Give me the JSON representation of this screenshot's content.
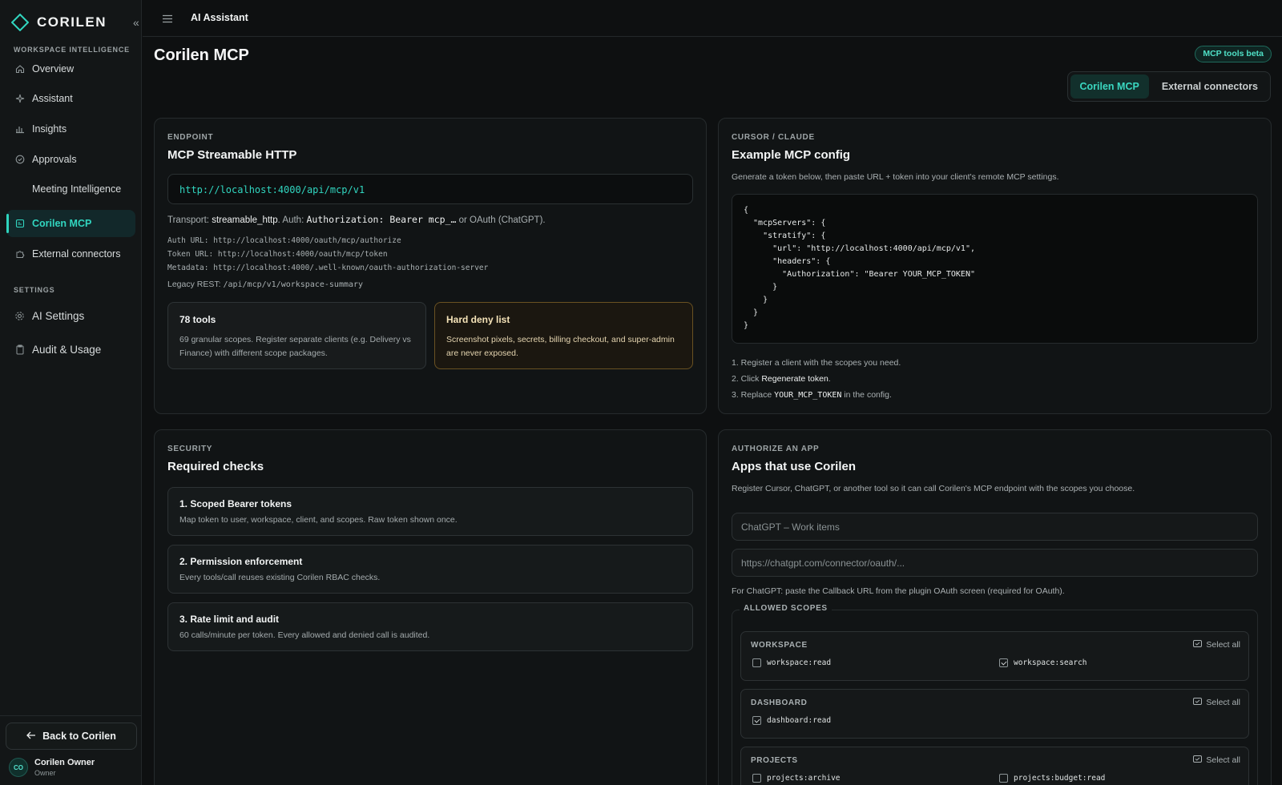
{
  "app": {
    "brand": "CORILEN",
    "topbar_title": "AI Assistant"
  },
  "sidebar": {
    "section_workspace": "WORKSPACE INTELLIGENCE",
    "section_settings": "SETTINGS",
    "items": [
      {
        "label": "Overview",
        "icon": "home-icon"
      },
      {
        "label": "Assistant",
        "icon": "sparkle-icon"
      },
      {
        "label": "Insights",
        "icon": "bar-chart-icon"
      },
      {
        "label": "Approvals",
        "icon": "check-circle-icon"
      },
      {
        "label": "Meeting Intelligence",
        "icon": ""
      },
      {
        "label": "Corilen MCP",
        "icon": "mcp-icon",
        "active": true
      },
      {
        "label": "External connectors",
        "icon": "puzzle-icon"
      }
    ],
    "settings_items": [
      {
        "label": "AI Settings",
        "icon": "gear-icon"
      },
      {
        "label": "Audit & Usage",
        "icon": "clipboard-icon"
      }
    ],
    "back_label": "Back to Corilen",
    "user": {
      "initials": "CO",
      "name": "Corilen Owner",
      "role": "Owner"
    }
  },
  "header": {
    "title": "Corilen MCP",
    "badge": "MCP tools beta",
    "tabs": [
      {
        "label": "Corilen MCP",
        "active": true
      },
      {
        "label": "External connectors",
        "active": false
      }
    ]
  },
  "endpoint": {
    "eyebrow": "ENDPOINT",
    "title": "MCP Streamable HTTP",
    "url": "http://localhost:4000/api/mcp/v1",
    "transport_prefix": "Transport: ",
    "transport_value": "streamable_http",
    "auth_prefix": ". Auth: ",
    "auth_value": "Authorization: Bearer mcp_…",
    "auth_suffix": " or OAuth (ChatGPT).",
    "auth_url": "Auth URL: http://localhost:4000/oauth/mcp/authorize",
    "token_url": "Token URL: http://localhost:4000/oauth/mcp/token",
    "metadata_url": "Metadata: http://localhost:4000/.well-known/oauth-authorization-server",
    "legacy_prefix": "Legacy REST: ",
    "legacy_path": "/api/mcp/v1/workspace-summary",
    "tools_title": "78 tools",
    "tools_desc": "69 granular scopes. Register separate clients (e.g. Delivery vs Finance) with different scope packages.",
    "deny_title": "Hard deny list",
    "deny_desc": "Screenshot pixels, secrets, billing checkout, and super-admin are never exposed."
  },
  "config": {
    "eyebrow": "CURSOR / CLAUDE",
    "title": "Example MCP config",
    "desc": "Generate a token below, then paste URL + token into your client's remote MCP settings.",
    "code": "{\n  \"mcpServers\": {\n    \"stratify\": {\n      \"url\": \"http://localhost:4000/api/mcp/v1\",\n      \"headers\": {\n        \"Authorization\": \"Bearer YOUR_MCP_TOKEN\"\n      }\n    }\n  }\n}",
    "step1": "1. Register a client with the scopes you need.",
    "step2_prefix": "2. Click ",
    "step2_action": "Regenerate token",
    "step2_suffix": ".",
    "step3_prefix": "3. Replace ",
    "step3_token": "YOUR_MCP_TOKEN",
    "step3_suffix": " in the config."
  },
  "security": {
    "eyebrow": "SECURITY",
    "title": "Required checks",
    "checks": [
      {
        "title": "1. Scoped Bearer tokens",
        "desc": "Map token to user, workspace, client, and scopes. Raw token shown once."
      },
      {
        "title": "2. Permission enforcement",
        "desc": "Every tools/call reuses existing Corilen RBAC checks."
      },
      {
        "title": "3. Rate limit and audit",
        "desc": "60 calls/minute per token. Every allowed and denied call is audited."
      }
    ]
  },
  "authorize": {
    "eyebrow": "AUTHORIZE AN APP",
    "title": "Apps that use Corilen",
    "desc": "Register Cursor, ChatGPT, or another tool so it can call Corilen's MCP endpoint with the scopes you choose.",
    "name_placeholder": "ChatGPT – Work items",
    "callback_placeholder": "https://chatgpt.com/connector/oauth/...",
    "callback_help": "For ChatGPT: paste the Callback URL from the plugin OAuth screen (required for OAuth).",
    "scopes_legend": "ALLOWED SCOPES",
    "select_all": "Select all",
    "groups": [
      {
        "name": "WORKSPACE",
        "scopes": [
          {
            "id": "workspace:read",
            "checked": false
          },
          {
            "id": "workspace:search",
            "checked": true
          }
        ]
      },
      {
        "name": "DASHBOARD",
        "scopes": [
          {
            "id": "dashboard:read",
            "checked": true
          }
        ]
      },
      {
        "name": "PROJECTS",
        "scopes": [
          {
            "id": "projects:archive",
            "checked": false
          },
          {
            "id": "projects:budget:read",
            "checked": false
          }
        ]
      }
    ]
  },
  "colors": {
    "accent": "#31d6c0",
    "background": "#0e1011",
    "warning_border": "#6a5222"
  }
}
